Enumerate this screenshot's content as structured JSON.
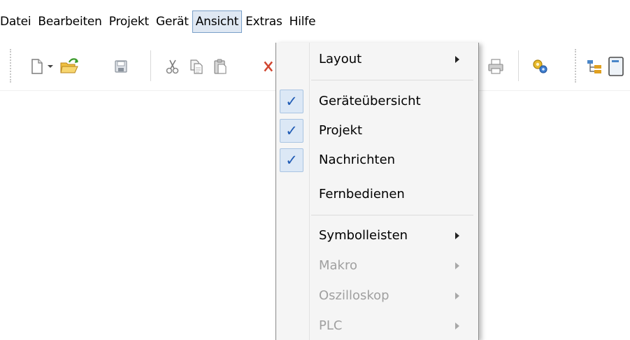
{
  "menubar": {
    "items": [
      "Datei",
      "Bearbeiten",
      "Projekt",
      "Gerät",
      "Ansicht",
      "Extras",
      "Hilfe"
    ],
    "active": "Ansicht"
  },
  "toolbar": {
    "buttons": [
      "new-document-icon",
      "dropdown-arrow-icon",
      "open-folder-icon",
      "save-icon",
      "cut-icon",
      "copy-icon",
      "paste-icon",
      "print-icon",
      "settings-gears-icon",
      "device-tree-icon"
    ]
  },
  "view_menu": {
    "items": [
      {
        "label": "Layout",
        "checked": false,
        "submenu": true,
        "disabled": false
      },
      {
        "label": "Geräteübersicht",
        "checked": true,
        "submenu": false,
        "disabled": false
      },
      {
        "label": "Projekt",
        "checked": true,
        "submenu": false,
        "disabled": false
      },
      {
        "label": "Nachrichten",
        "checked": true,
        "submenu": false,
        "disabled": false
      },
      {
        "label": "Fernbedienen",
        "checked": false,
        "submenu": false,
        "disabled": false
      },
      {
        "label": "Symbolleisten",
        "checked": false,
        "submenu": true,
        "disabled": false
      },
      {
        "label": "Makro",
        "checked": false,
        "submenu": true,
        "disabled": true
      },
      {
        "label": "Oszilloskop",
        "checked": false,
        "submenu": true,
        "disabled": true
      },
      {
        "label": "PLC",
        "checked": false,
        "submenu": true,
        "disabled": true
      }
    ],
    "check_glyph": "✓"
  },
  "colors": {
    "menu_highlight": "#dfe8f3",
    "menu_highlight_border": "#7aa0c8",
    "check_color": "#1f5bb5",
    "disabled_text": "#a0a0a0"
  }
}
